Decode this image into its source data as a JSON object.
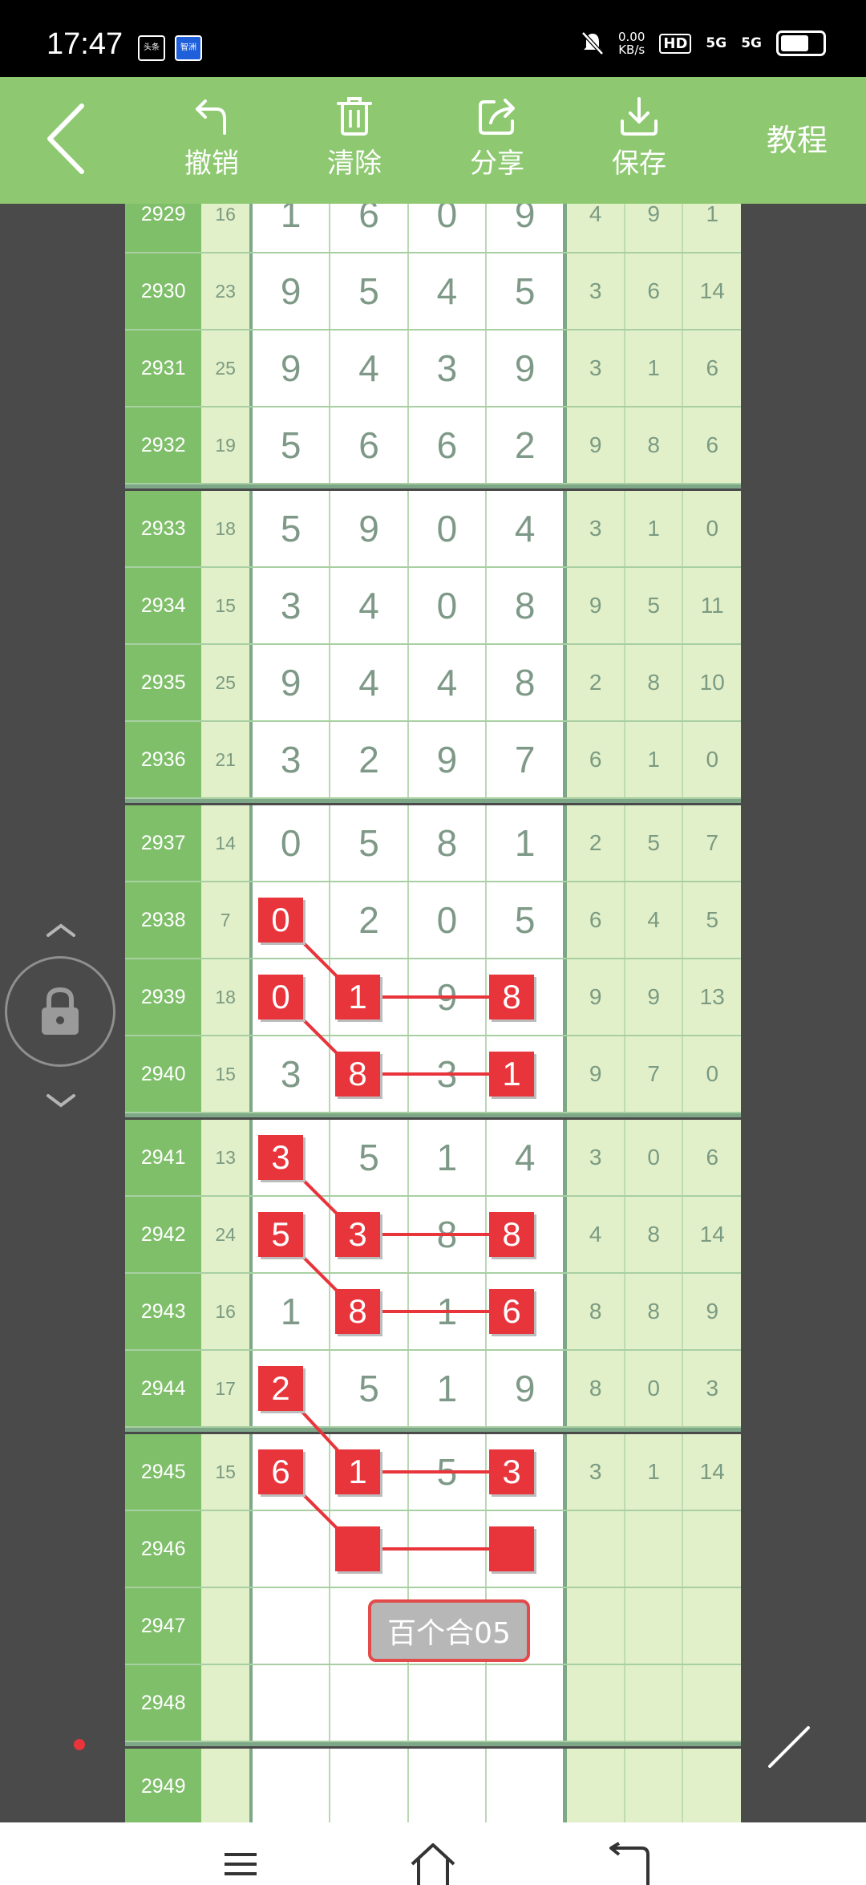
{
  "status_bar": {
    "time": "17:47",
    "apps": [
      "头条",
      "智洲"
    ],
    "net_speed": "0.00\nKB/s",
    "net_speed_value": "0.00",
    "net_speed_unit": "KB/s",
    "hd": "HD",
    "sim1": "5G",
    "sim2": "5G"
  },
  "toolbar": {
    "undo_label": "撤销",
    "clear_label": "清除",
    "share_label": "分享",
    "save_label": "保存",
    "tutorial_label": "教程"
  },
  "rows": [
    {
      "issue": "2929",
      "sum": "16",
      "digits": [
        "1",
        "6",
        "0",
        "9"
      ],
      "stats": [
        "4",
        "9",
        "1"
      ]
    },
    {
      "issue": "2930",
      "sum": "23",
      "digits": [
        "9",
        "5",
        "4",
        "5"
      ],
      "stats": [
        "3",
        "6",
        "14"
      ]
    },
    {
      "issue": "2931",
      "sum": "25",
      "digits": [
        "9",
        "4",
        "3",
        "9"
      ],
      "stats": [
        "3",
        "1",
        "6"
      ]
    },
    {
      "issue": "2932",
      "sum": "19",
      "digits": [
        "5",
        "6",
        "6",
        "2"
      ],
      "stats": [
        "9",
        "8",
        "6"
      ]
    },
    {
      "issue": "2933",
      "sum": "18",
      "digits": [
        "5",
        "9",
        "0",
        "4"
      ],
      "stats": [
        "3",
        "1",
        "0"
      ]
    },
    {
      "issue": "2934",
      "sum": "15",
      "digits": [
        "3",
        "4",
        "0",
        "8"
      ],
      "stats": [
        "9",
        "5",
        "11"
      ]
    },
    {
      "issue": "2935",
      "sum": "25",
      "digits": [
        "9",
        "4",
        "4",
        "8"
      ],
      "stats": [
        "2",
        "8",
        "10"
      ]
    },
    {
      "issue": "2936",
      "sum": "21",
      "digits": [
        "3",
        "2",
        "9",
        "7"
      ],
      "stats": [
        "6",
        "1",
        "0"
      ]
    },
    {
      "issue": "2937",
      "sum": "14",
      "digits": [
        "0",
        "5",
        "8",
        "1"
      ],
      "stats": [
        "2",
        "5",
        "7"
      ]
    },
    {
      "issue": "2938",
      "sum": "7",
      "digits": [
        "0",
        "2",
        "0",
        "5"
      ],
      "stats": [
        "6",
        "4",
        "5"
      ]
    },
    {
      "issue": "2939",
      "sum": "18",
      "digits": [
        "0",
        "1",
        "9",
        "8"
      ],
      "stats": [
        "9",
        "9",
        "13"
      ]
    },
    {
      "issue": "2940",
      "sum": "15",
      "digits": [
        "3",
        "8",
        "3",
        "1"
      ],
      "stats": [
        "9",
        "7",
        "0"
      ]
    },
    {
      "issue": "2941",
      "sum": "13",
      "digits": [
        "3",
        "5",
        "1",
        "4"
      ],
      "stats": [
        "3",
        "0",
        "6"
      ]
    },
    {
      "issue": "2942",
      "sum": "24",
      "digits": [
        "5",
        "3",
        "8",
        "8"
      ],
      "stats": [
        "4",
        "8",
        "14"
      ]
    },
    {
      "issue": "2943",
      "sum": "16",
      "digits": [
        "1",
        "8",
        "1",
        "6"
      ],
      "stats": [
        "8",
        "8",
        "9"
      ]
    },
    {
      "issue": "2944",
      "sum": "17",
      "digits": [
        "2",
        "5",
        "1",
        "9"
      ],
      "stats": [
        "8",
        "0",
        "3"
      ]
    },
    {
      "issue": "2945",
      "sum": "15",
      "digits": [
        "6",
        "1",
        "5",
        "3"
      ],
      "stats": [
        "3",
        "1",
        "14"
      ]
    },
    {
      "issue": "2946",
      "sum": "",
      "digits": [
        "",
        "",
        "",
        ""
      ],
      "stats": [
        "",
        "",
        ""
      ]
    },
    {
      "issue": "2947",
      "sum": "",
      "digits": [
        "",
        "",
        "",
        ""
      ],
      "stats": [
        "",
        "",
        ""
      ]
    },
    {
      "issue": "2948",
      "sum": "",
      "digits": [
        "",
        "",
        "",
        ""
      ],
      "stats": [
        "",
        "",
        ""
      ]
    },
    {
      "issue": "2949",
      "sum": "",
      "digits": [
        "",
        "",
        "",
        ""
      ],
      "stats": [
        "",
        "",
        ""
      ]
    }
  ],
  "marks": [
    {
      "row": 9,
      "col": 0,
      "value": "0"
    },
    {
      "row": 10,
      "col": 0,
      "value": "0"
    },
    {
      "row": 10,
      "col": 1,
      "value": "1"
    },
    {
      "row": 10,
      "col": 3,
      "value": "8"
    },
    {
      "row": 11,
      "col": 1,
      "value": "8"
    },
    {
      "row": 11,
      "col": 3,
      "value": "1"
    },
    {
      "row": 12,
      "col": 0,
      "value": "3"
    },
    {
      "row": 13,
      "col": 0,
      "value": "5"
    },
    {
      "row": 13,
      "col": 1,
      "value": "3"
    },
    {
      "row": 13,
      "col": 3,
      "value": "8"
    },
    {
      "row": 14,
      "col": 1,
      "value": "8"
    },
    {
      "row": 14,
      "col": 3,
      "value": "6"
    },
    {
      "row": 15,
      "col": 0,
      "value": "2"
    },
    {
      "row": 16,
      "col": 0,
      "value": "6"
    },
    {
      "row": 16,
      "col": 1,
      "value": "1"
    },
    {
      "row": 16,
      "col": 3,
      "value": "3"
    },
    {
      "row": 17,
      "col": 1,
      "value": ""
    },
    {
      "row": 17,
      "col": 3,
      "value": ""
    }
  ],
  "links": [
    [
      [
        9,
        0
      ],
      [
        10,
        1
      ]
    ],
    [
      [
        10,
        1
      ],
      [
        10,
        3
      ]
    ],
    [
      [
        10,
        0
      ],
      [
        11,
        1
      ]
    ],
    [
      [
        11,
        1
      ],
      [
        11,
        3
      ]
    ],
    [
      [
        12,
        0
      ],
      [
        13,
        1
      ]
    ],
    [
      [
        13,
        1
      ],
      [
        13,
        3
      ]
    ],
    [
      [
        13,
        0
      ],
      [
        14,
        1
      ]
    ],
    [
      [
        14,
        1
      ],
      [
        14,
        3
      ]
    ],
    [
      [
        15,
        0
      ],
      [
        16,
        1
      ]
    ],
    [
      [
        16,
        1
      ],
      [
        16,
        3
      ]
    ],
    [
      [
        16,
        0
      ],
      [
        17,
        1
      ]
    ],
    [
      [
        17,
        1
      ],
      [
        17,
        3
      ]
    ]
  ],
  "tag_label": "百个合05",
  "colors": {
    "toolbar": "#8ec971",
    "issue_col": "#7fbf6a",
    "light_col": "#e2f0c9",
    "mark": "#e8343b",
    "digit_text": "#7e9987"
  },
  "icons": [
    "back-arrow-icon",
    "undo-icon",
    "trash-icon",
    "share-icon",
    "download-icon",
    "lock-icon",
    "chevron-up-icon",
    "chevron-down-icon",
    "pen-icon",
    "menu-icon",
    "home-icon",
    "back-nav-icon"
  ]
}
